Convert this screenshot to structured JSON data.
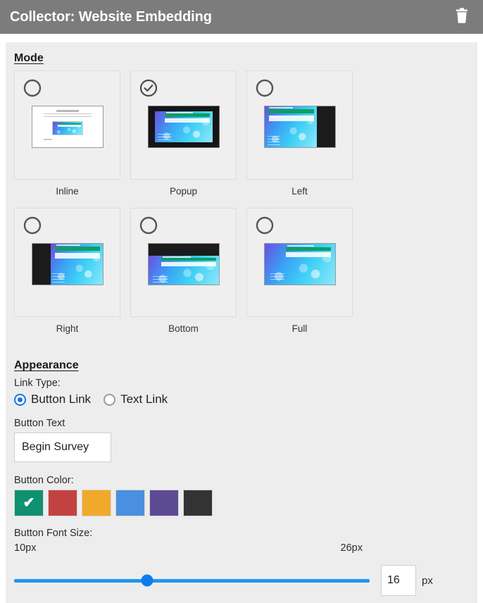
{
  "header": {
    "title": "Collector: Website Embedding",
    "delete_icon": "trash-icon",
    "background": "#7c7c7c"
  },
  "mode": {
    "section_title": "Mode",
    "selected": "Popup",
    "options": [
      {
        "label": "Inline",
        "selected": false,
        "thumb": "inline"
      },
      {
        "label": "Popup",
        "selected": true,
        "thumb": "popup"
      },
      {
        "label": "Left",
        "selected": false,
        "thumb": "left"
      },
      {
        "label": "Right",
        "selected": false,
        "thumb": "right"
      },
      {
        "label": "Bottom",
        "selected": false,
        "thumb": "bottom"
      },
      {
        "label": "Full",
        "selected": false,
        "thumb": "full"
      }
    ]
  },
  "appearance": {
    "section_title": "Appearance",
    "link_type_label": "Link Type:",
    "link_types": [
      {
        "label": "Button Link",
        "selected": true
      },
      {
        "label": "Text Link",
        "selected": false
      }
    ],
    "button_text_label": "Button Text",
    "button_text_value": "Begin Survey",
    "button_color_label": "Button Color:",
    "colors": [
      {
        "name": "green",
        "hex": "#0f9171",
        "selected": true
      },
      {
        "name": "red",
        "hex": "#c24242",
        "selected": false
      },
      {
        "name": "orange",
        "hex": "#f0a92a",
        "selected": false
      },
      {
        "name": "blue",
        "hex": "#4b8fe0",
        "selected": false
      },
      {
        "name": "purple",
        "hex": "#5e4a93",
        "selected": false
      },
      {
        "name": "dark",
        "hex": "#333333",
        "selected": false
      }
    ],
    "check_glyph": "✔",
    "font_size_label": "Button Font Size:",
    "font_size_min_label": "10px",
    "font_size_max_label": "26px",
    "font_size_min": 10,
    "font_size_max": 26,
    "font_size_value": "16",
    "font_size_unit": "px",
    "slider_color": "#2196f3",
    "thumb_color": "#0b7cee"
  }
}
